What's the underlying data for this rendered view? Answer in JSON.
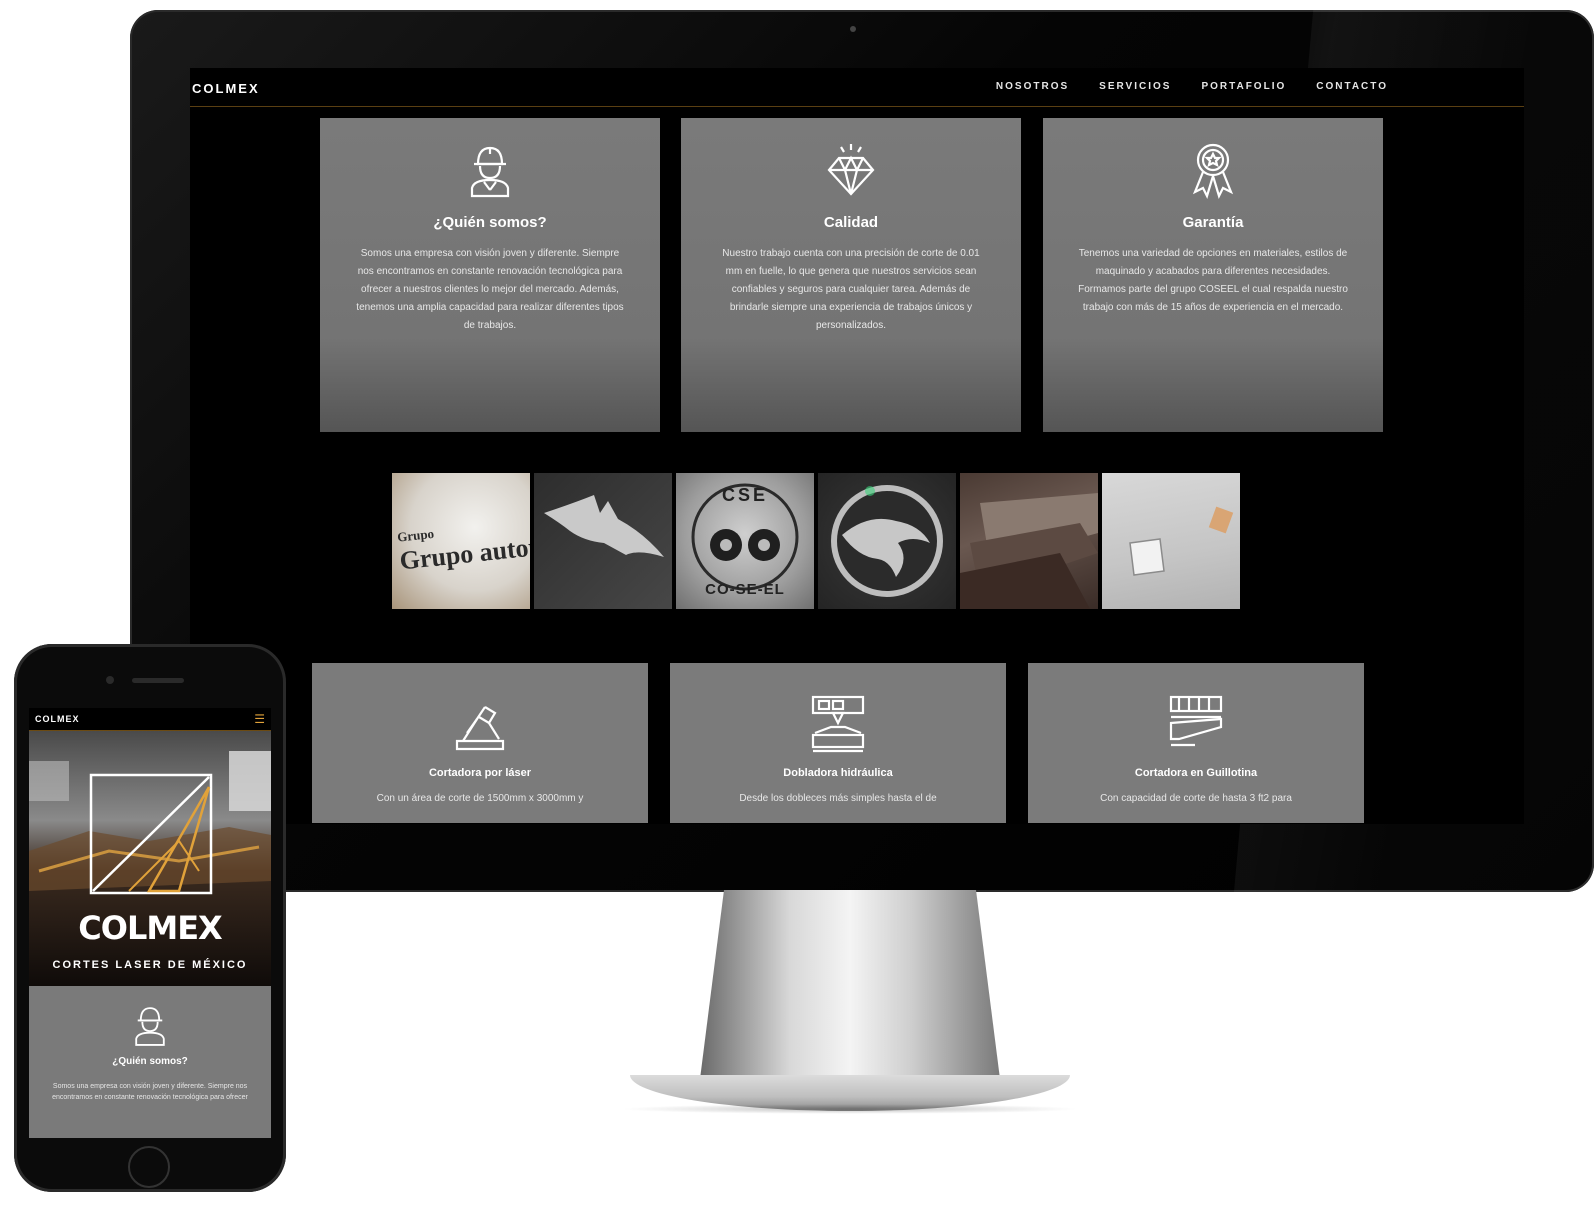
{
  "desktop": {
    "brand": "COLMEX",
    "nav": [
      "NOSOTROS",
      "SERVICIOS",
      "PORTAFOLIO",
      "CONTACTO"
    ],
    "features": [
      {
        "icon": "worker-icon",
        "title": "¿Quién somos?",
        "text": "Somos una empresa con visión joven y diferente. Siempre nos encontramos en constante renovación tecnológica para ofrecer a nuestros clientes lo mejor del mercado. Además, tenemos una amplia capacidad para realizar diferentes tipos de trabajos."
      },
      {
        "icon": "diamond-icon",
        "title": "Calidad",
        "text": "Nuestro trabajo cuenta con una precisión de corte de 0.01 mm en fuelle, lo que genera que nuestros servicios sean confiables y seguros para cualquier tarea. Además de brindarle siempre una experiencia de trabajos únicos y personalizados."
      },
      {
        "icon": "award-ribbon-icon",
        "title": "Garantía",
        "text": "Tenemos una variedad de opciones en materiales, estilos de maquinado y acabados para diferentes necesidades. Formamos parte del grupo COSEEL el cual respalda nuestro trabajo con más de 15 años de experiencia en el mercado."
      }
    ],
    "gallery": [
      {
        "name": "gallery-thumb-grupo-autoprogreso",
        "text": "Grupo autoprogre"
      },
      {
        "name": "gallery-thumb-bat",
        "text": ""
      },
      {
        "name": "gallery-thumb-coseel",
        "text": "CSE CO-SE-EL"
      },
      {
        "name": "gallery-thumb-dragon",
        "text": ""
      },
      {
        "name": "gallery-thumb-sheets",
        "text": ""
      },
      {
        "name": "gallery-thumb-panel",
        "text": ""
      }
    ],
    "services": [
      {
        "icon": "laser-arm-icon",
        "title": "Cortadora por láser",
        "text": "Con un área de corte de 1500mm x 3000mm y"
      },
      {
        "icon": "press-brake-icon",
        "title": "Dobladora hidráulica",
        "text": "Desde los dobleces más simples hasta el de"
      },
      {
        "icon": "guillotine-icon",
        "title": "Cortadora en Guillotina",
        "text": "Con capacidad de corte de hasta 3 ft2 para"
      }
    ]
  },
  "mobile": {
    "brand": "COLMEX",
    "menu_icon": "hamburger-icon",
    "logo": "COLMEX",
    "tagline": "CORTES LASER DE MÉXICO",
    "card": {
      "icon": "worker-icon",
      "title": "¿Quién somos?",
      "text": "Somos una empresa con visión joven y diferente. Siempre nos encontramos en constante renovación tecnológica para ofrecer"
    }
  },
  "colors": {
    "accent": "#e1a23a",
    "card": "#7a7a7a",
    "background": "#000000"
  }
}
